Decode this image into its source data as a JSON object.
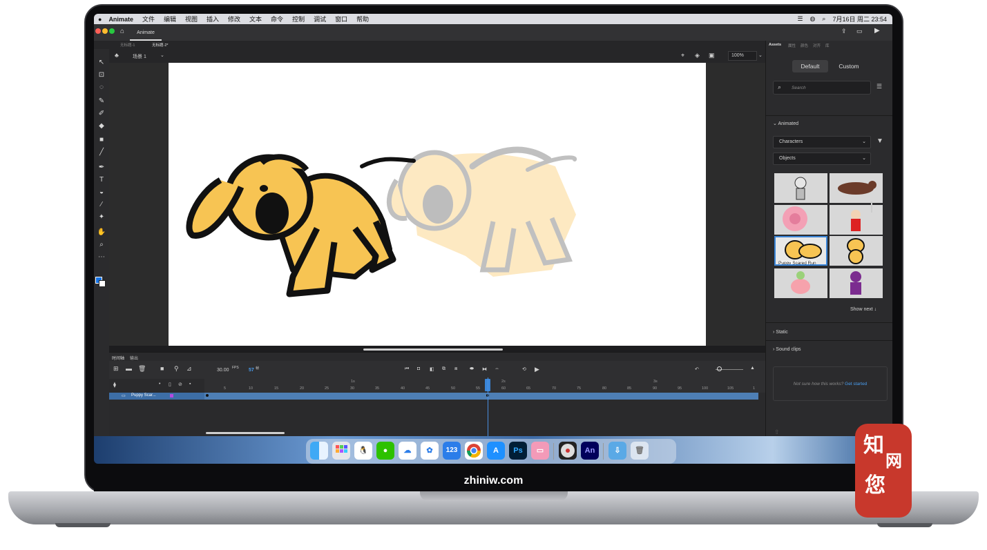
{
  "brand": {
    "footer_text": "zhiniw.com",
    "seal_chars": [
      "知",
      "网",
      "您"
    ]
  },
  "menubar": {
    "apple_icon": "apple-icon",
    "app_name": "Animate",
    "items": [
      "文件",
      "编辑",
      "视图",
      "插入",
      "修改",
      "文本",
      "命令",
      "控制",
      "调试",
      "窗口",
      "帮助"
    ],
    "clock": "7月16日 周二 23:54"
  },
  "titlebar": {
    "home_tab": "Animate"
  },
  "doc_tabs": [
    "无标题-1",
    "无标题-2*"
  ],
  "scene": {
    "label": "场景 1",
    "zoom": "100%"
  },
  "timeline": {
    "tabs": [
      "时间轴",
      "输出"
    ],
    "fps": "30.00",
    "fps_unit": "FPS",
    "current_frame": "57",
    "frame_unit": "帧",
    "layer_name": "Puppy Scar...",
    "seconds_markers": [
      "1s",
      "2s",
      "3s"
    ],
    "ruler_ticks": [
      "5",
      "10",
      "15",
      "20",
      "25",
      "30",
      "35",
      "40",
      "45",
      "50",
      "55",
      "60",
      "65",
      "70",
      "75",
      "80",
      "85",
      "90",
      "95",
      "100",
      "105",
      "1"
    ]
  },
  "panel": {
    "tabs": [
      "Assets",
      "属性",
      "颜色",
      "对齐",
      "库"
    ],
    "seg_default": "Default",
    "seg_custom": "Custom",
    "search_placeholder": "Search",
    "section_animated": "Animated",
    "dropdown_characters": "Characters",
    "dropdown_objects": "Objects",
    "selected_caption": "Puppy Scared Run",
    "show_next": "Show next ↓",
    "section_static": "Static",
    "section_sound": "Sound clips",
    "promo_text": "Not sure how this works?",
    "promo_link": "Get started"
  },
  "dock": {
    "apps": [
      "finder-icon",
      "launchpad-icon",
      "qq-icon",
      "wechat-icon",
      "cloud-icon",
      "photos-icon",
      "123-icon",
      "chrome-icon",
      "appstore-icon",
      "ps-icon",
      "cleaner-icon",
      "dvd-icon",
      "an-icon",
      "downloads-icon",
      "trash-icon"
    ],
    "labels": {
      "ps": "Ps",
      "an": "An",
      "num": "123"
    }
  }
}
